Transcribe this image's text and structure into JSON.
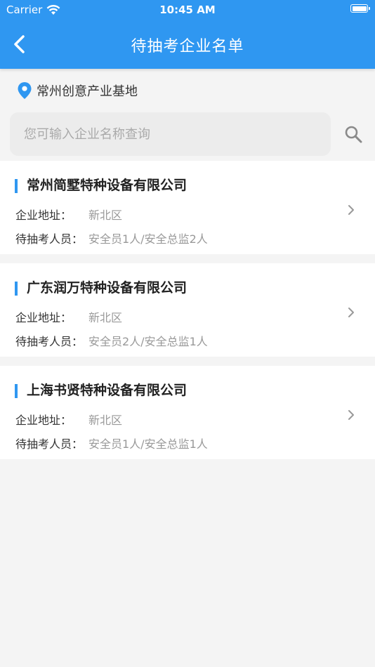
{
  "status_bar": {
    "carrier": "Carrier",
    "time": "10:45 AM"
  },
  "nav": {
    "title": "待抽考企业名单"
  },
  "location": {
    "name": "常州创意产业基地"
  },
  "search": {
    "placeholder": "您可输入企业名称查询",
    "value": ""
  },
  "labels": {
    "address": "企业地址：",
    "personnel": "待抽考人员："
  },
  "companies": [
    {
      "name": "常州简墅特种设备有限公司",
      "address": "新北区",
      "personnel": "安全员1人/安全总监2人"
    },
    {
      "name": "广东润万特种设备有限公司",
      "address": "新北区",
      "personnel": "安全员2人/安全总监1人"
    },
    {
      "name": "上海书贤特种设备有限公司",
      "address": "新北区",
      "personnel": "安全员1人/安全总监1人"
    }
  ],
  "colors": {
    "accent": "#2f97f1",
    "background": "#f4f4f4"
  },
  "icons": {
    "back": "chevron-left-icon",
    "location": "map-pin-icon",
    "search": "search-icon",
    "row_arrow": "chevron-right-icon"
  }
}
